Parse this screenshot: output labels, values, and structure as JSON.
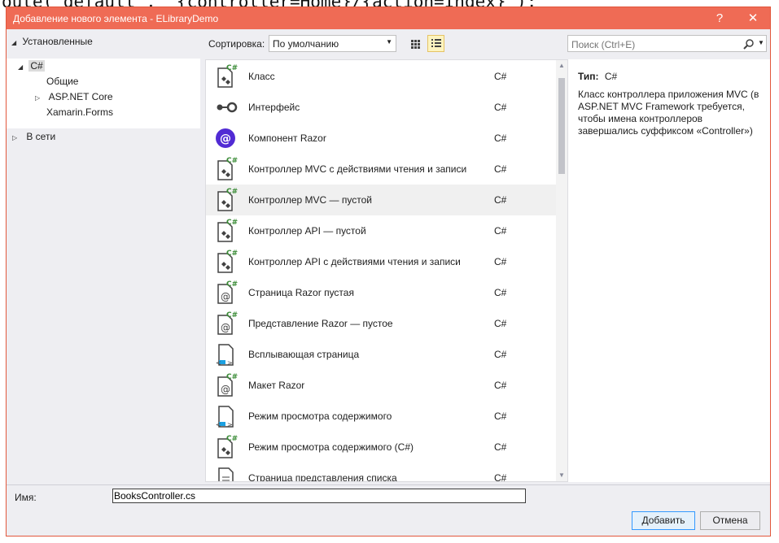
{
  "background_code": "oute(\"default\", \"{controller=Home}/{action=Index}\");",
  "window": {
    "title": "Добавление нового элемента - ELibraryDemo",
    "help_glyph": "?",
    "close_glyph": "✕"
  },
  "tree": {
    "installed_label": "Установленные",
    "csharp_label": "C#",
    "children": [
      "Общие",
      "ASP.NET Core",
      "Xamarin.Forms"
    ],
    "online_label": "В сети"
  },
  "sort": {
    "label": "Сортировка:",
    "value": "По умолчанию"
  },
  "search": {
    "placeholder": "Поиск (Ctrl+E)"
  },
  "templates": [
    {
      "name": "Класс",
      "lang": "C#",
      "icon": "class-file-icon"
    },
    {
      "name": "Интерфейс",
      "lang": "C#",
      "icon": "interface-icon"
    },
    {
      "name": "Компонент Razor",
      "lang": "C#",
      "icon": "razor-component-icon"
    },
    {
      "name": "Контроллер MVC с действиями чтения и записи",
      "lang": "C#",
      "icon": "controller-file-icon"
    },
    {
      "name": "Контроллер MVC — пустой",
      "lang": "C#",
      "icon": "controller-file-icon"
    },
    {
      "name": "Контроллер API — пустой",
      "lang": "C#",
      "icon": "controller-file-icon"
    },
    {
      "name": "Контроллер API с действиями чтения и записи",
      "lang": "C#",
      "icon": "controller-file-icon"
    },
    {
      "name": "Страница Razor пустая",
      "lang": "C#",
      "icon": "razor-page-icon"
    },
    {
      "name": "Представление Razor — пустое",
      "lang": "C#",
      "icon": "razor-page-icon"
    },
    {
      "name": "Всплывающая страница",
      "lang": "C#",
      "icon": "popup-page-icon"
    },
    {
      "name": "Макет Razor",
      "lang": "C#",
      "icon": "razor-page-icon"
    },
    {
      "name": "Режим просмотра содержимого",
      "lang": "C#",
      "icon": "popup-page-icon"
    },
    {
      "name": "Режим просмотра содержимого (C#)",
      "lang": "C#",
      "icon": "controller-file-icon"
    },
    {
      "name": "Страница представления списка",
      "lang": "C#",
      "icon": "list-page-icon"
    }
  ],
  "selected_index": 4,
  "details": {
    "type_label": "Тип:",
    "type_value": "C#",
    "description": "Класс контроллера приложения MVC (в ASP.NET MVC Framework требуется, чтобы имена контроллеров завершались суффиксом «Controller»)"
  },
  "name_field": {
    "label": "Имя:",
    "value": "BooksController.cs"
  },
  "buttons": {
    "add": "Добавить",
    "cancel": "Отмена"
  },
  "colors": {
    "title_bar": "#ef6b55",
    "csharp_green": "#388a34",
    "selection": "#f0f0f0"
  }
}
